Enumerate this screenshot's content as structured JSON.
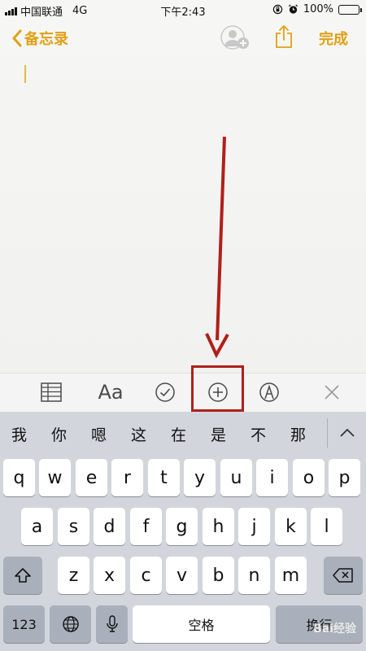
{
  "status_bar": {
    "carrier": "中国联通",
    "network": "4G",
    "time": "下午2:43",
    "battery_percent": "100%",
    "battery_level": 1.0
  },
  "nav": {
    "back_label": "备忘录",
    "done_label": "完成",
    "accent_color": "#e0a118"
  },
  "note": {
    "content": ""
  },
  "toolbar": {
    "items": [
      {
        "name": "table-icon"
      },
      {
        "name": "format",
        "label": "Aa"
      },
      {
        "name": "checklist-icon"
      },
      {
        "name": "add-icon"
      },
      {
        "name": "markup-icon"
      },
      {
        "name": "close-icon"
      }
    ],
    "highlight_color": "#b01f1a"
  },
  "candidates": [
    "我",
    "你",
    "嗯",
    "这",
    "在",
    "是",
    "不",
    "那"
  ],
  "keyboard": {
    "row1": [
      "q",
      "w",
      "e",
      "r",
      "t",
      "y",
      "u",
      "i",
      "o",
      "p"
    ],
    "row2": [
      "a",
      "s",
      "d",
      "f",
      "g",
      "h",
      "j",
      "k",
      "l"
    ],
    "row3": [
      "z",
      "x",
      "c",
      "v",
      "b",
      "n",
      "m"
    ],
    "numbers_label": "123",
    "space_label": "空格",
    "return_label": "换行"
  },
  "watermark": "Bai经验"
}
